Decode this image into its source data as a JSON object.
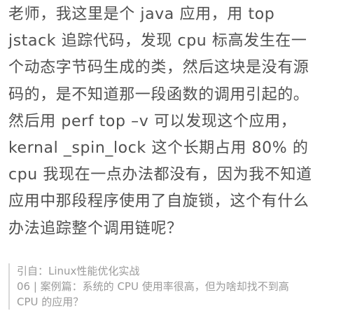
{
  "question": {
    "lines": [
      "老师，我这里是个 java 应用，用 top",
      "jstack 追踪代码，发现 cpu 标高发生在一",
      "个动态字节码生成的类，然后这块是没有源",
      "码的，是不知道那一段函数的调用引起的。",
      "然后用 perf top –v 可以发现这个应用，",
      "kernal _spin_lock 这个长期占用 80% 的",
      "cpu 我现在一点办法都没有，因为我不知道",
      "应用中那段程序使用了自旋锁，这个有什么",
      "办法追踪整个调用链呢？"
    ]
  },
  "quote": {
    "source_line": "引自：Linux性能优化实战",
    "article_line1": "06 | 案例篇：系统的 CPU 使用率很高，但为啥却找不到高",
    "article_line2": "CPU 的应用？"
  }
}
